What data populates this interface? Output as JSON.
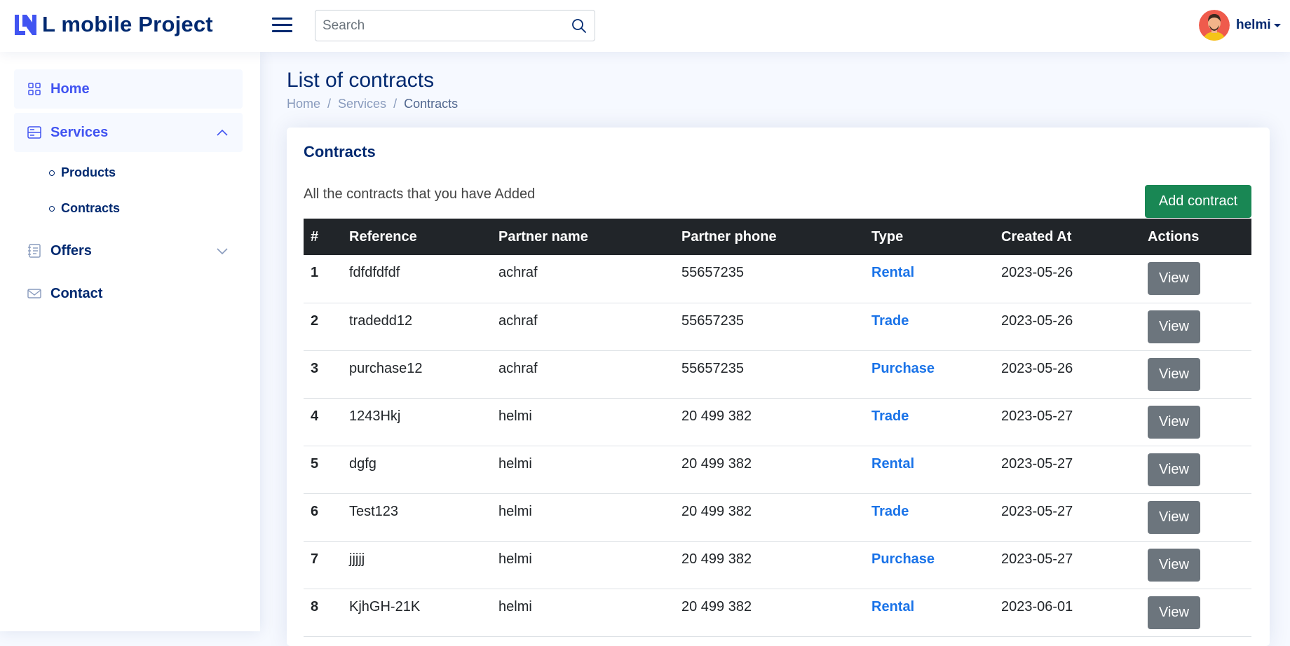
{
  "header": {
    "app_title": "L mobile Project",
    "search_placeholder": "Search",
    "user_name": "helmi"
  },
  "sidebar": {
    "items": [
      {
        "label": "Home",
        "icon": "grid-icon"
      },
      {
        "label": "Services",
        "icon": "layout-text-icon",
        "expanded": true
      },
      {
        "label": "Offers",
        "icon": "journal-text-icon",
        "expanded": false
      },
      {
        "label": "Contact",
        "icon": "envelope-icon"
      }
    ],
    "services_children": [
      {
        "label": "Products"
      },
      {
        "label": "Contracts"
      }
    ]
  },
  "page": {
    "title": "List of contracts",
    "breadcrumb": [
      "Home",
      "Services",
      "Contracts"
    ]
  },
  "card": {
    "title": "Contracts",
    "subtitle": "All the contracts that you have Added",
    "add_button": "Add contract"
  },
  "table": {
    "columns": [
      "#",
      "Reference",
      "Partner name",
      "Partner phone",
      "Type",
      "Created At",
      "Actions"
    ],
    "view_label": "View",
    "rows": [
      {
        "num": "1",
        "reference": "fdfdfdfdf",
        "partner": "achraf",
        "phone": "55657235",
        "type": "Rental",
        "created": "2023-05-26"
      },
      {
        "num": "2",
        "reference": "tradedd12",
        "partner": "achraf",
        "phone": "55657235",
        "type": "Trade",
        "created": "2023-05-26"
      },
      {
        "num": "3",
        "reference": "purchase12",
        "partner": "achraf",
        "phone": "55657235",
        "type": "Purchase",
        "created": "2023-05-26"
      },
      {
        "num": "4",
        "reference": "1243Hkj",
        "partner": "helmi",
        "phone": "20 499 382",
        "type": "Trade",
        "created": "2023-05-27"
      },
      {
        "num": "5",
        "reference": "dgfg",
        "partner": "helmi",
        "phone": "20 499 382",
        "type": "Rental",
        "created": "2023-05-27"
      },
      {
        "num": "6",
        "reference": "Test123",
        "partner": "helmi",
        "phone": "20 499 382",
        "type": "Trade",
        "created": "2023-05-27"
      },
      {
        "num": "7",
        "reference": "jjjjj",
        "partner": "helmi",
        "phone": "20 499 382",
        "type": "Purchase",
        "created": "2023-05-27"
      },
      {
        "num": "8",
        "reference": "KjhGH-21K",
        "partner": "helmi",
        "phone": "20 499 382",
        "type": "Rental",
        "created": "2023-06-01"
      }
    ]
  },
  "colors": {
    "brand": "#012970",
    "accent": "#4154f1",
    "success": "#198754",
    "secondary": "#6c757d",
    "type_link": "#1a73e8"
  }
}
